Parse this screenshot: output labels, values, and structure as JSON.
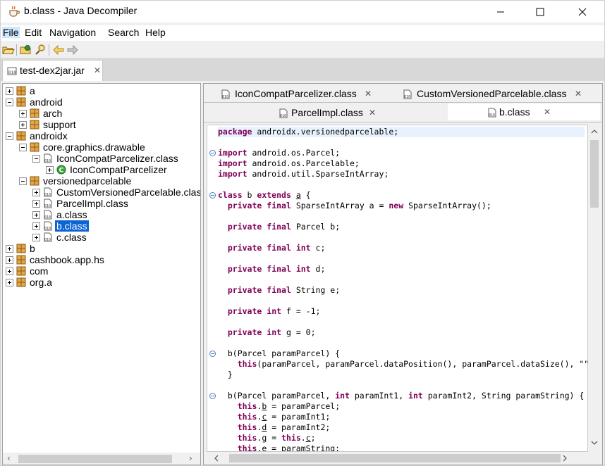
{
  "window": {
    "title": "b.class - Java Decompiler",
    "controls": {
      "minimize": "—",
      "maximize": "☐",
      "close": "✕"
    }
  },
  "menu": [
    "File",
    "Edit",
    "Navigation",
    "Search",
    "Help"
  ],
  "toolbar": {
    "icons": [
      "open-file-icon",
      "open-type-icon",
      "search-type-icon",
      "back-icon",
      "forward-icon"
    ]
  },
  "jar_tab": {
    "label": "test-dex2jar.jar",
    "close": "✕"
  },
  "tree": [
    {
      "label": "a"
    },
    {
      "label": "android"
    },
    {
      "label": "arch"
    },
    {
      "label": "support"
    },
    {
      "label": "androidx"
    },
    {
      "label": "core.graphics.drawable"
    },
    {
      "label": "IconCompatParcelizer.class"
    },
    {
      "label": "IconCompatParcelizer"
    },
    {
      "label": "versionedparcelable"
    },
    {
      "label": "CustomVersionedParcelable.class"
    },
    {
      "label": "ParcelImpl.class"
    },
    {
      "label": "a.class"
    },
    {
      "label": "b.class"
    },
    {
      "label": "c.class"
    },
    {
      "label": "b"
    },
    {
      "label": "cashbook.app.hs"
    },
    {
      "label": "com"
    },
    {
      "label": "org.a"
    }
  ],
  "editor_tabs": [
    {
      "label": "IconCompatParcelizer.class",
      "close": "✕"
    },
    {
      "label": "CustomVersionedParcelable.class",
      "close": "✕"
    },
    {
      "label": "ParcelImpl.class",
      "close": "✕"
    },
    {
      "label": "b.class",
      "close": "✕"
    }
  ],
  "code": [
    "package androidx.versionedparcelable;",
    "",
    "import android.os.Parcel;",
    "import android.os.Parcelable;",
    "import android.util.SparseIntArray;",
    "",
    "class b extends a {",
    "  private final SparseIntArray a = new SparseIntArray();",
    "",
    "  private final Parcel b;",
    "",
    "  private final int c;",
    "",
    "  private final int d;",
    "",
    "  private final String e;",
    "",
    "  private int f = -1;",
    "",
    "  private int g = 0;",
    "",
    "  b(Parcel paramParcel) {",
    "    this(paramParcel, paramParcel.dataPosition(), paramParcel.dataSize(), \"\");",
    "  }",
    "",
    "  b(Parcel paramParcel, int paramInt1, int paramInt2, String paramString) {",
    "    this.b = paramParcel;",
    "    this.c = paramInt1;",
    "    this.d = paramInt2;",
    "    this.g = this.c;",
    "    this.e = paramString;"
  ],
  "scroll": {
    "left": "<",
    "right": ">",
    "up": "^",
    "down": "v"
  }
}
